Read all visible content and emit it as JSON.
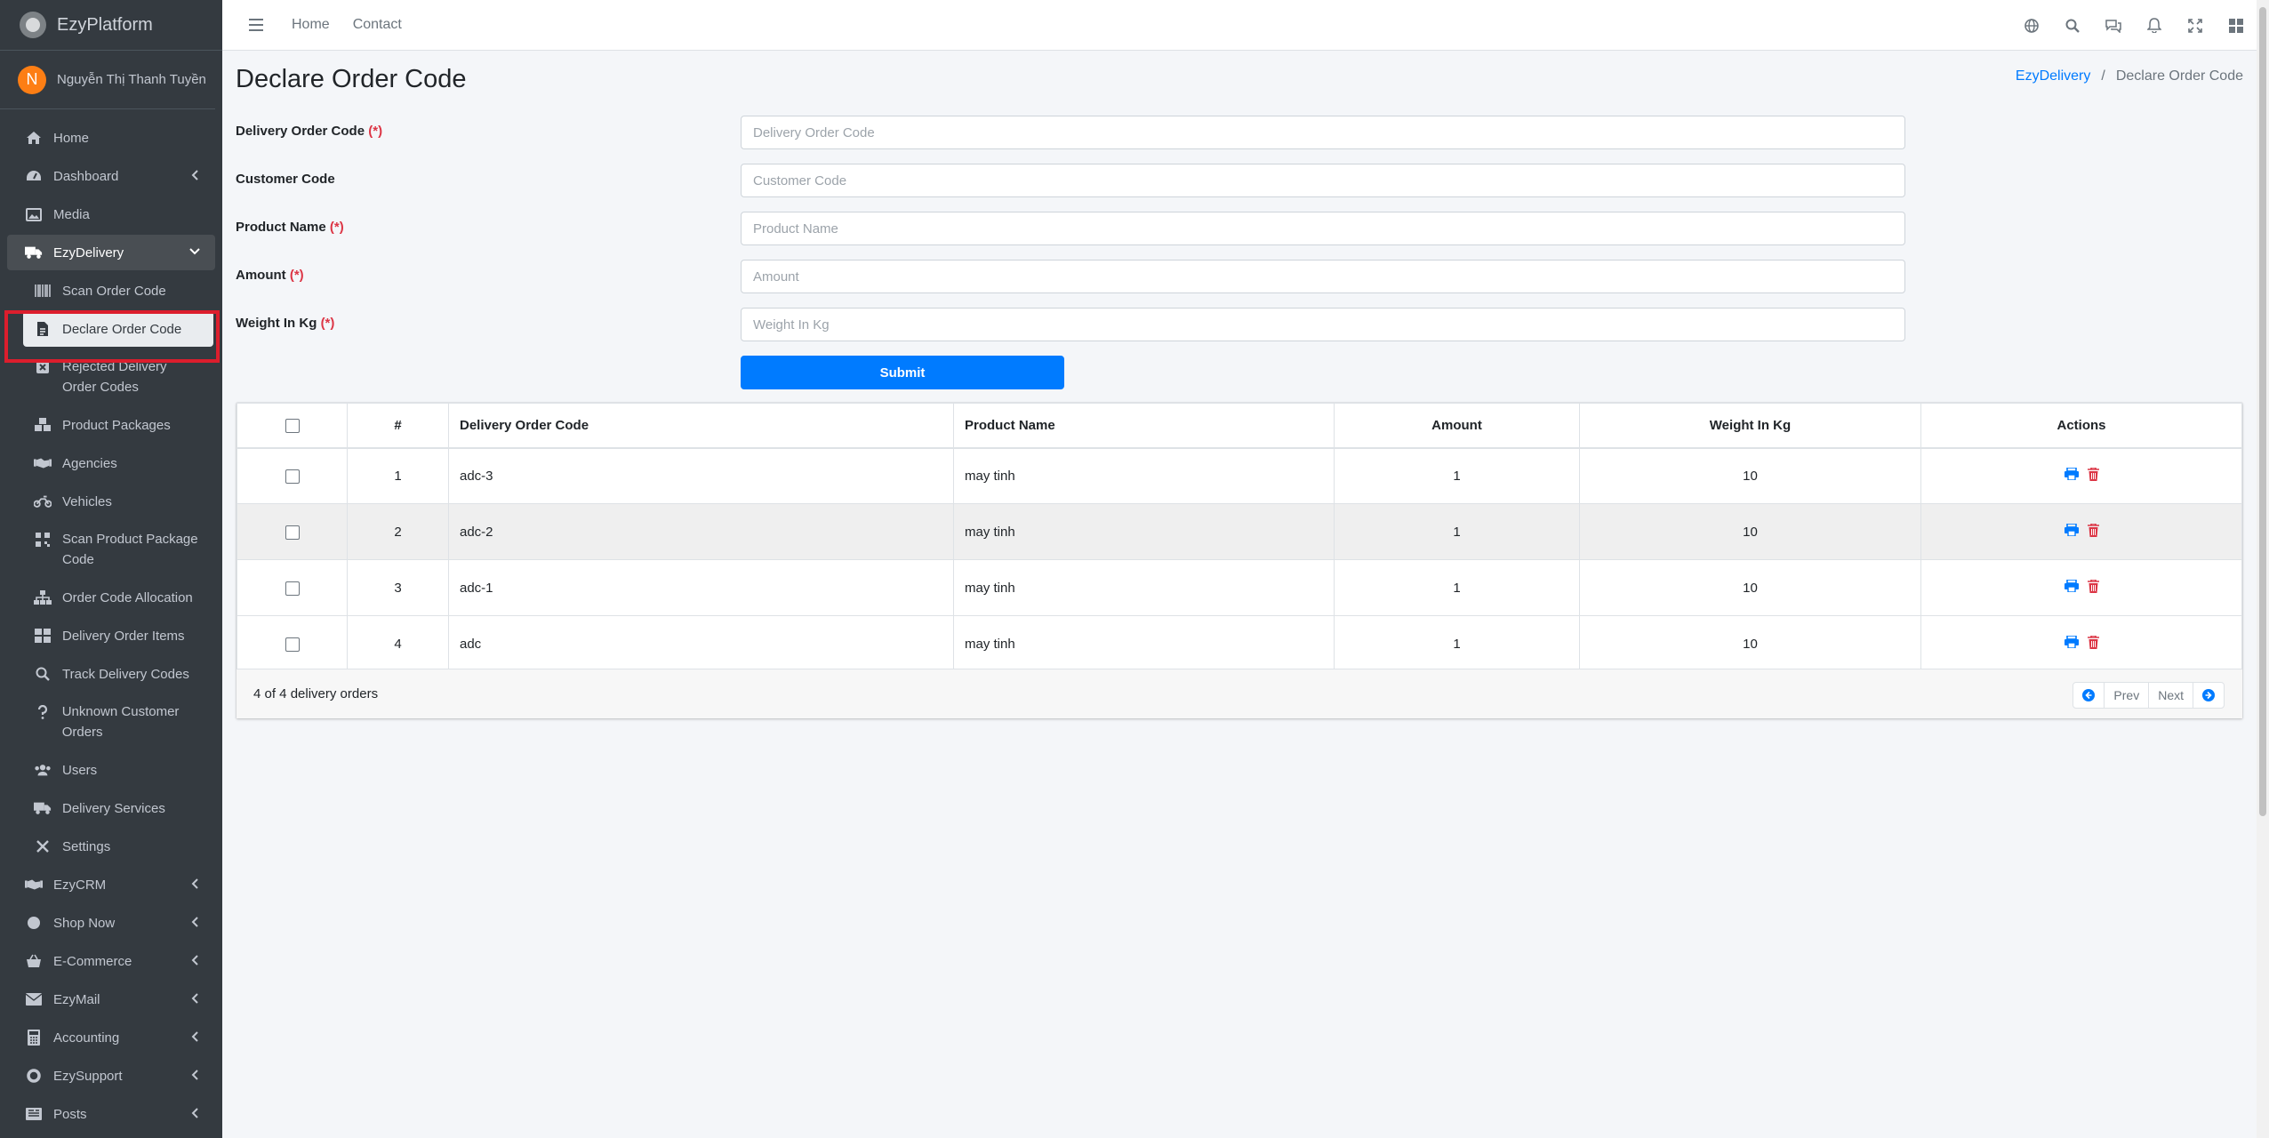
{
  "brand": {
    "name": "EzyPlatform"
  },
  "user": {
    "initial": "N",
    "name": "Nguyễn Thị Thanh Tuyền"
  },
  "sidebar": {
    "top_items": [
      {
        "label": "Home",
        "icon": "home-icon"
      },
      {
        "label": "Dashboard",
        "icon": "dashboard-icon"
      },
      {
        "label": "Media",
        "icon": "image-icon"
      }
    ],
    "ezydelivery": {
      "label": "EzyDelivery",
      "children": [
        "Scan Order Code",
        "Declare Order Code",
        "Rejected Delivery Order Codes",
        "Product Packages",
        "Agencies",
        "Vehicles",
        "Scan Product Package Code",
        "Order Code Allocation",
        "Delivery Order Items",
        "Track Delivery Codes",
        "Unknown Customer Orders",
        "Users",
        "Delivery Services",
        "Settings"
      ]
    },
    "bottom_items": [
      "EzyCRM",
      "Shop Now",
      "E-Commerce",
      "EzyMail",
      "Accounting",
      "EzySupport",
      "Posts"
    ]
  },
  "topbar": {
    "links": [
      "Home",
      "Contact"
    ]
  },
  "page": {
    "title": "Declare Order Code",
    "breadcrumb": {
      "parent": "EzyDelivery",
      "separator": "/",
      "current": "Declare Order Code"
    }
  },
  "form": {
    "fields": [
      {
        "label": "Delivery Order Code",
        "required": "(*)",
        "placeholder": "Delivery Order Code"
      },
      {
        "label": "Customer Code",
        "required": "",
        "placeholder": "Customer Code"
      },
      {
        "label": "Product Name",
        "required": "(*)",
        "placeholder": "Product Name"
      },
      {
        "label": "Amount",
        "required": "(*)",
        "placeholder": "Amount"
      },
      {
        "label": "Weight In Kg",
        "required": "(*)",
        "placeholder": "Weight In Kg"
      }
    ],
    "submit_label": "Submit"
  },
  "table": {
    "headers": [
      "#",
      "Delivery Order Code",
      "Product Name",
      "Amount",
      "Weight In Kg",
      "Actions"
    ],
    "rows": [
      {
        "num": "1",
        "code": "adc-3",
        "product": "may tinh",
        "amount": "1",
        "weight": "10"
      },
      {
        "num": "2",
        "code": "adc-2",
        "product": "may tinh",
        "amount": "1",
        "weight": "10"
      },
      {
        "num": "3",
        "code": "adc-1",
        "product": "may tinh",
        "amount": "1",
        "weight": "10"
      },
      {
        "num": "4",
        "code": "adc",
        "product": "may tinh",
        "amount": "1",
        "weight": "10"
      }
    ],
    "summary": "4 of 4 delivery orders",
    "pager": {
      "prev": "Prev",
      "next": "Next"
    }
  },
  "colors": {
    "primary": "#007bff",
    "danger": "#dc3545",
    "sidebar_bg": "#343a40",
    "highlight_border": "#dc1e2d"
  }
}
